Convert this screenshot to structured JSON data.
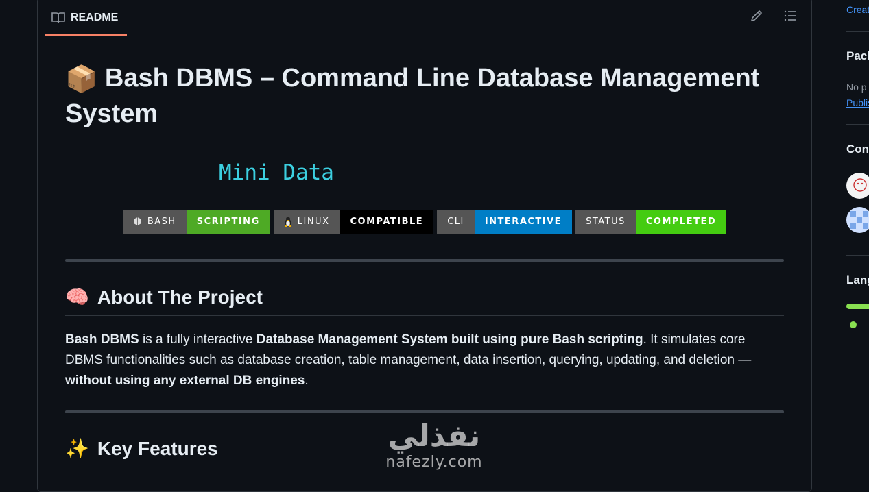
{
  "readme": {
    "tab_label": "README",
    "tab_icon": "book-icon",
    "edit_icon": "pencil-icon",
    "outline_icon": "list-icon"
  },
  "title": {
    "emoji": "📦",
    "text": "Bash DBMS – Command Line Database Management System"
  },
  "banner_text": "Mini Data",
  "badges": [
    {
      "label": "BASH",
      "value": "SCRIPTING",
      "value_color": "#4eaa25",
      "icon": "terminal-icon"
    },
    {
      "label": "LINUX",
      "value": "COMPATIBLE",
      "value_color": "#000000",
      "icon": "penguin-icon"
    },
    {
      "label": "CLI",
      "value": "INTERACTIVE",
      "value_color": "#007ec6"
    },
    {
      "label": "STATUS",
      "value": "COMPLETED",
      "value_color": "#44cc11"
    }
  ],
  "about": {
    "emoji": "🧠",
    "heading": "About The Project",
    "p1_bold": "Bash DBMS",
    "p2": " is a fully interactive ",
    "p3_bold": "Database Management System built using pure Bash scripting",
    "p4": ". It simulates core DBMS functionalities such as database creation, table management, data insertion, querying, updating, and deletion — ",
    "p5_bold": "without using any external DB engines",
    "p6": "."
  },
  "features": {
    "emoji": "✨",
    "heading": "Key Features"
  },
  "sidebar": {
    "create_link": "Creat",
    "packages_heading": "Pack",
    "packages_text": "No p",
    "publish_link": "Publis",
    "contributors_heading": "Con",
    "languages_heading": "Lang",
    "language_color": "#89e051"
  },
  "watermark": {
    "arabic": "نفذلي",
    "latin": "nafezly.com"
  }
}
